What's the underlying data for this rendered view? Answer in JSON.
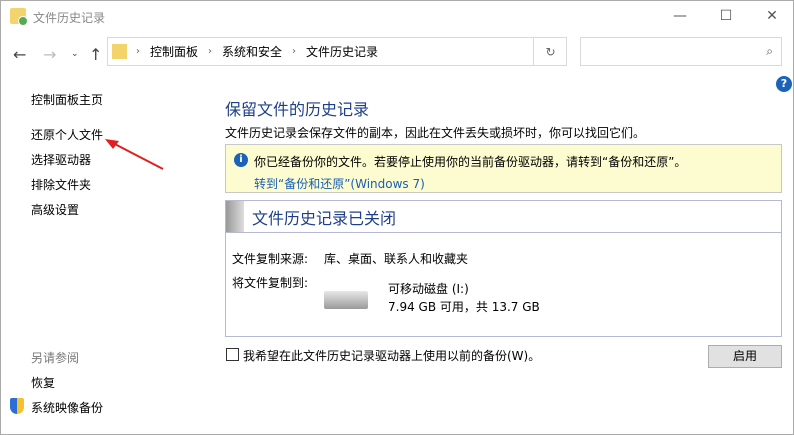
{
  "window": {
    "title": "文件历史记录",
    "minimize": "—",
    "maximize": "☐",
    "close": "✕"
  },
  "breadcrumb": [
    "控制面板",
    "系统和安全",
    "文件历史记录"
  ],
  "sidebar": {
    "items": [
      "控制面板主页",
      "还原个人文件",
      "选择驱动器",
      "排除文件夹",
      "高级设置"
    ],
    "see_also": "另请参阅",
    "links": [
      "恢复",
      "系统映像备份"
    ]
  },
  "main": {
    "title": "保留文件的历史记录",
    "desc": "文件历史记录会保存文件的副本，因此在文件丢失或损坏时，你可以找回它们。",
    "info_text": "你已经备份你的文件。若要停止使用你的当前备份驱动器，请转到“备份和还原”。",
    "info_link": "转到“备份和还原”(Windows 7)",
    "status": "文件历史记录已关闭",
    "source_label": "文件复制来源:",
    "source_value": "库、桌面、联系人和收藏夹",
    "dest_label": "将文件复制到:",
    "drive_name": "可移动磁盘 (I:)",
    "drive_space": "7.94 GB 可用，共 13.7 GB",
    "checkbox_label": "我希望在此文件历史记录驱动器上使用以前的备份(W)。",
    "enable_button": "启用"
  }
}
